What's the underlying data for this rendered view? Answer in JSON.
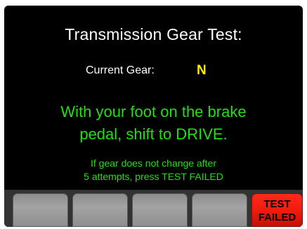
{
  "screen": {
    "title": "Transmission Gear Test:",
    "current_gear_label": "Current Gear:",
    "current_gear_value": "N",
    "instruction_line1": "With your foot on the brake",
    "instruction_line2": "pedal, shift to DRIVE.",
    "hint_line1": "If gear does not change after",
    "hint_line2": "5 attempts, press TEST FAILED"
  },
  "softkeys": {
    "fail_line1": "TEST",
    "fail_line2": "FAILED"
  },
  "colors": {
    "background": "#000000",
    "title_text": "#ffffff",
    "gear_value": "#ffee00",
    "instruction_text": "#22e010",
    "fail_button": "#ee1a0c",
    "softkey_gray": "#a3a3a3"
  }
}
